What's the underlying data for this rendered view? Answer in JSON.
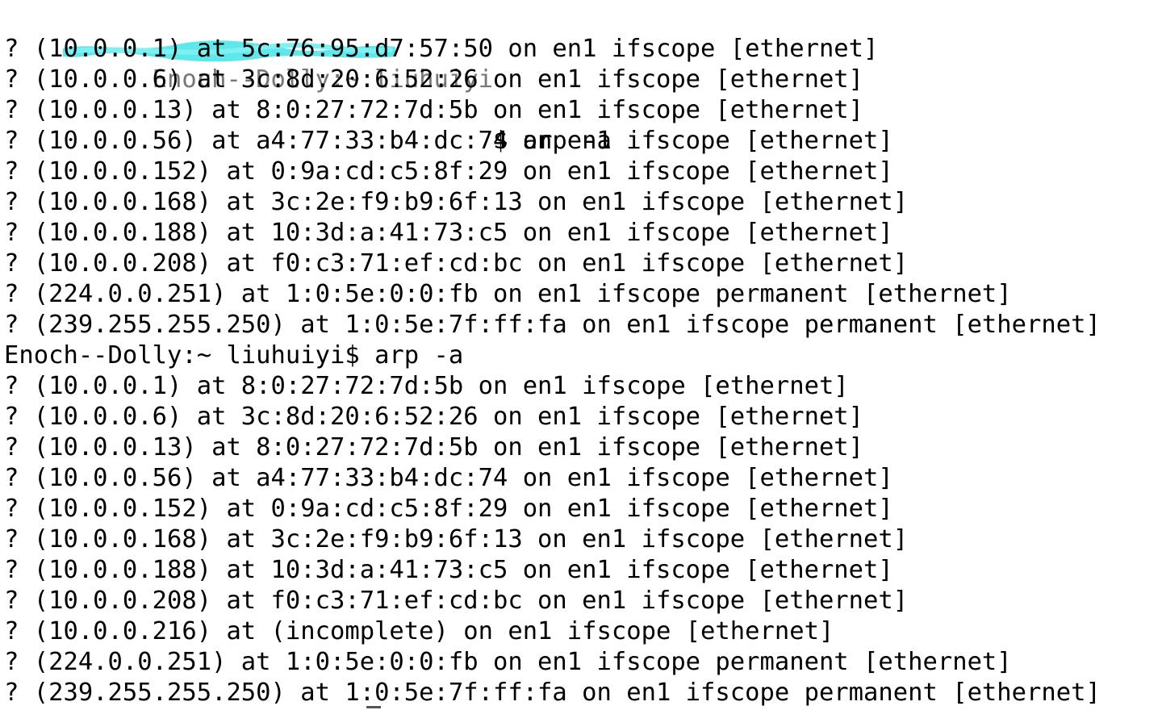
{
  "terminal": {
    "first_prompt": {
      "redacted_user_host": "Enoch--Dolly:~ liuhuiyi",
      "suffix": "$ arp -a"
    },
    "first_output": [
      "? (10.0.0.1) at 5c:76:95:d7:57:50 on en1 ifscope [ethernet]",
      "? (10.0.0.6) at 3c:8d:20:6:52:26 on en1 ifscope [ethernet]",
      "? (10.0.0.13) at 8:0:27:72:7d:5b on en1 ifscope [ethernet]",
      "? (10.0.0.56) at a4:77:33:b4:dc:74 on en1 ifscope [ethernet]",
      "? (10.0.0.152) at 0:9a:cd:c5:8f:29 on en1 ifscope [ethernet]",
      "? (10.0.0.168) at 3c:2e:f9:b9:6f:13 on en1 ifscope [ethernet]",
      "? (10.0.0.188) at 10:3d:a:41:73:c5 on en1 ifscope [ethernet]",
      "? (10.0.0.208) at f0:c3:71:ef:cd:bc on en1 ifscope [ethernet]",
      "? (224.0.0.251) at 1:0:5e:0:0:fb on en1 ifscope permanent [ethernet]",
      "? (239.255.255.250) at 1:0:5e:7f:ff:fa on en1 ifscope permanent [ethernet]"
    ],
    "second_prompt": "Enoch--Dolly:~ liuhuiyi$ arp -a",
    "second_output": [
      "? (10.0.0.1) at 8:0:27:72:7d:5b on en1 ifscope [ethernet]",
      "? (10.0.0.6) at 3c:8d:20:6:52:26 on en1 ifscope [ethernet]",
      "? (10.0.0.13) at 8:0:27:72:7d:5b on en1 ifscope [ethernet]",
      "? (10.0.0.56) at a4:77:33:b4:dc:74 on en1 ifscope [ethernet]",
      "? (10.0.0.152) at 0:9a:cd:c5:8f:29 on en1 ifscope [ethernet]",
      "? (10.0.0.168) at 3c:2e:f9:b9:6f:13 on en1 ifscope [ethernet]",
      "? (10.0.0.188) at 10:3d:a:41:73:c5 on en1 ifscope [ethernet]",
      "? (10.0.0.208) at f0:c3:71:ef:cd:bc on en1 ifscope [ethernet]",
      "? (10.0.0.216) at (incomplete) on en1 ifscope [ethernet]",
      "? (224.0.0.251) at 1:0:5e:0:0:fb on en1 ifscope permanent [ethernet]",
      "? (239.255.255.250) at 1:0:5e:7f:ff:fa on en1 ifscope permanent [ethernet]"
    ]
  },
  "colors": {
    "background": "#ffffff",
    "text": "#000000",
    "redaction_highlight": "#5ee8ec"
  }
}
